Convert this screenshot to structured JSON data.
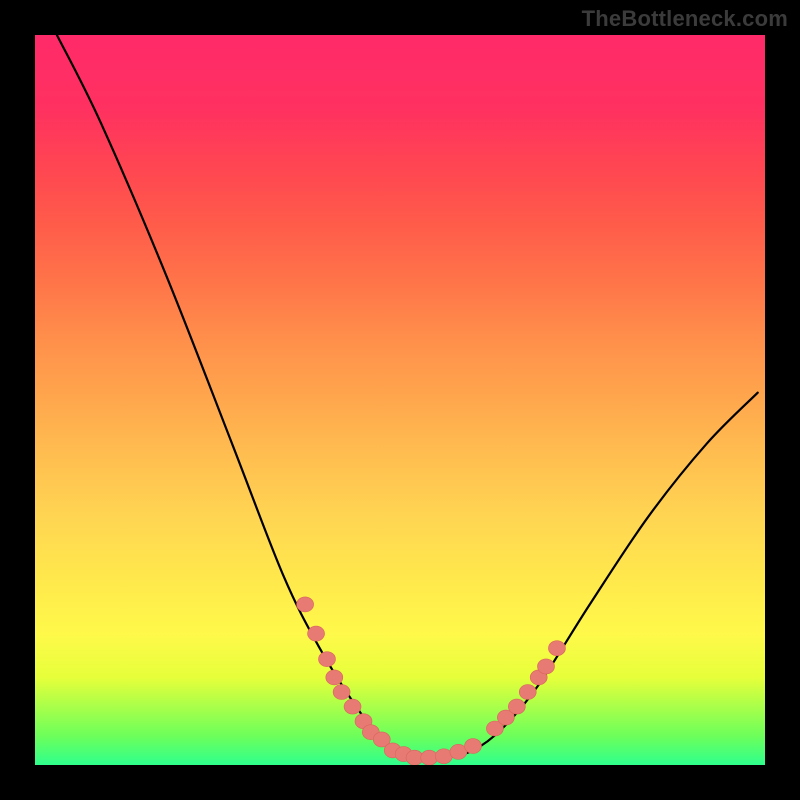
{
  "attribution": "TheBottleneck.com",
  "colors": {
    "background_black": "#000000",
    "curve_stroke": "#000000",
    "bead_fill": "#e77a72",
    "bead_stroke": "#d9665e",
    "gradient_top": "#ff2a69",
    "gradient_mid": "#ffd552",
    "gradient_bottom": "#2fff8d"
  },
  "chart_data": {
    "type": "line",
    "title": "",
    "xlabel": "",
    "ylabel": "",
    "xlim": [
      0,
      100
    ],
    "ylim": [
      0,
      100
    ],
    "grid": false,
    "note": "No axes, ticks, or numeric labels are shown in the image; x scaled 0–100 left→right, y scaled 0–100 bottom→top based on plot box.",
    "series": [
      {
        "name": "main-curve",
        "style": "line",
        "points": [
          {
            "x": 3,
            "y": 100
          },
          {
            "x": 9,
            "y": 88
          },
          {
            "x": 18,
            "y": 67
          },
          {
            "x": 27,
            "y": 44
          },
          {
            "x": 34,
            "y": 26
          },
          {
            "x": 39,
            "y": 16
          },
          {
            "x": 44,
            "y": 8
          },
          {
            "x": 48,
            "y": 3
          },
          {
            "x": 52,
            "y": 1
          },
          {
            "x": 56,
            "y": 1
          },
          {
            "x": 60,
            "y": 2
          },
          {
            "x": 64,
            "y": 5
          },
          {
            "x": 69,
            "y": 11
          },
          {
            "x": 76,
            "y": 22
          },
          {
            "x": 84,
            "y": 34
          },
          {
            "x": 92,
            "y": 44
          },
          {
            "x": 99,
            "y": 51
          }
        ]
      },
      {
        "name": "left-beads",
        "style": "scatter",
        "color": "#e77a72",
        "points": [
          {
            "x": 37,
            "y": 22
          },
          {
            "x": 38.5,
            "y": 18
          },
          {
            "x": 40,
            "y": 14.5
          },
          {
            "x": 41,
            "y": 12
          },
          {
            "x": 42,
            "y": 10
          },
          {
            "x": 43.5,
            "y": 8
          },
          {
            "x": 45,
            "y": 6
          },
          {
            "x": 46,
            "y": 4.5
          },
          {
            "x": 47.5,
            "y": 3.5
          },
          {
            "x": 49,
            "y": 2
          },
          {
            "x": 50.5,
            "y": 1.5
          },
          {
            "x": 52,
            "y": 1
          },
          {
            "x": 54,
            "y": 1
          },
          {
            "x": 56,
            "y": 1.2
          },
          {
            "x": 58,
            "y": 1.8
          },
          {
            "x": 60,
            "y": 2.6
          }
        ]
      },
      {
        "name": "right-beads",
        "style": "scatter",
        "color": "#e77a72",
        "points": [
          {
            "x": 63,
            "y": 5
          },
          {
            "x": 64.5,
            "y": 6.5
          },
          {
            "x": 66,
            "y": 8
          },
          {
            "x": 67.5,
            "y": 10
          },
          {
            "x": 69,
            "y": 12
          },
          {
            "x": 70,
            "y": 13.5
          },
          {
            "x": 71.5,
            "y": 16
          }
        ]
      }
    ]
  }
}
